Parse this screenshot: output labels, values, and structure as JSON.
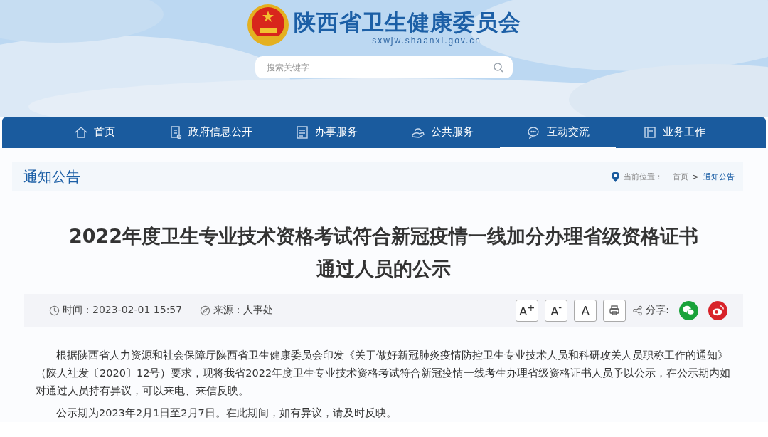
{
  "header": {
    "site_name": "陕西省卫生健康委员会",
    "url": "sxwjw.shaanxi.gov.cn",
    "search": {
      "placeholder": "搜索关键字"
    }
  },
  "nav": [
    {
      "label": "首页",
      "kind": "home",
      "selected": false
    },
    {
      "label": "政府信息公开",
      "kind": "doc",
      "selected": false
    },
    {
      "label": "办事服务",
      "kind": "list",
      "selected": false
    },
    {
      "label": "公共服务",
      "kind": "hand",
      "selected": false
    },
    {
      "label": "互动交流",
      "kind": "chat",
      "selected": true
    },
    {
      "label": "业务工作",
      "kind": "book",
      "selected": false
    }
  ],
  "section": {
    "title": "通知公告",
    "breadcrumb_label": "当前位置：",
    "breadcrumb": [
      "首页",
      "通知公告"
    ],
    "separator": ">"
  },
  "article": {
    "title_lines": [
      "2022年度卫生专业技术资格考试符合新冠疫情一线加分办理省级资格证书",
      "通过人员的公示"
    ],
    "time": "时间：2023-02-01 15:57",
    "source": "来源：人事处",
    "font_buttons": [
      "A$^{+}$",
      "A$^{-}$",
      "A"
    ],
    "share_label": "分享:",
    "paragraphs": [
      "根据陕西省人力资源和社会保障厅陕西省卫生健康委员会印发《关于做好新冠肺炎疫情防控卫生专业技术人员和科研攻关人员职称工作的通知》（陕人社发〔2020〕12号）要求，现将我省2022年度卫生专业技术资格考试符合新冠疫情一线考生办理省级资格证书人员予以公示，在公示期内如对通过人员持有异议，可以来电、来信反映。",
      "公示期为2023年2月1日至2月7日。在此期间，如有异议，请及时反映。"
    ]
  }
}
